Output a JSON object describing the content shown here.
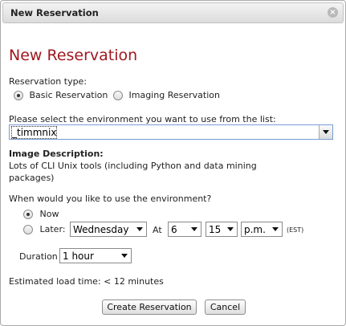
{
  "window": {
    "title": "New Reservation",
    "close_icon": "close-icon"
  },
  "heading": "New Reservation",
  "reservation_type": {
    "label": "Reservation type:",
    "options": [
      {
        "label": "Basic Reservation",
        "selected": true
      },
      {
        "label": "Imaging Reservation",
        "selected": false
      }
    ]
  },
  "environment": {
    "prompt": "Please select the environment you want to use from the list:",
    "selected": "_timmnix"
  },
  "image_description": {
    "label": "Image Description:",
    "text_line1": "Lots of CLI Unix tools (including Python and data mining",
    "text_line2": "packages)"
  },
  "when": {
    "prompt": "When would you like to use the environment?",
    "now_label": "Now",
    "now_selected": true,
    "later_label": "Later:",
    "later_selected": false,
    "day": "Wednesday",
    "at_label": "At",
    "hour": "6",
    "minute": "15",
    "ampm": "p.m.",
    "timezone": "(EST)"
  },
  "duration": {
    "label": "Duration",
    "value": "1 hour"
  },
  "estimate": "Estimated load time: < 12 minutes",
  "buttons": {
    "create": "Create Reservation",
    "cancel": "Cancel"
  },
  "colors": {
    "heading": "#a01820",
    "focus_border": "#7a9cd3"
  }
}
